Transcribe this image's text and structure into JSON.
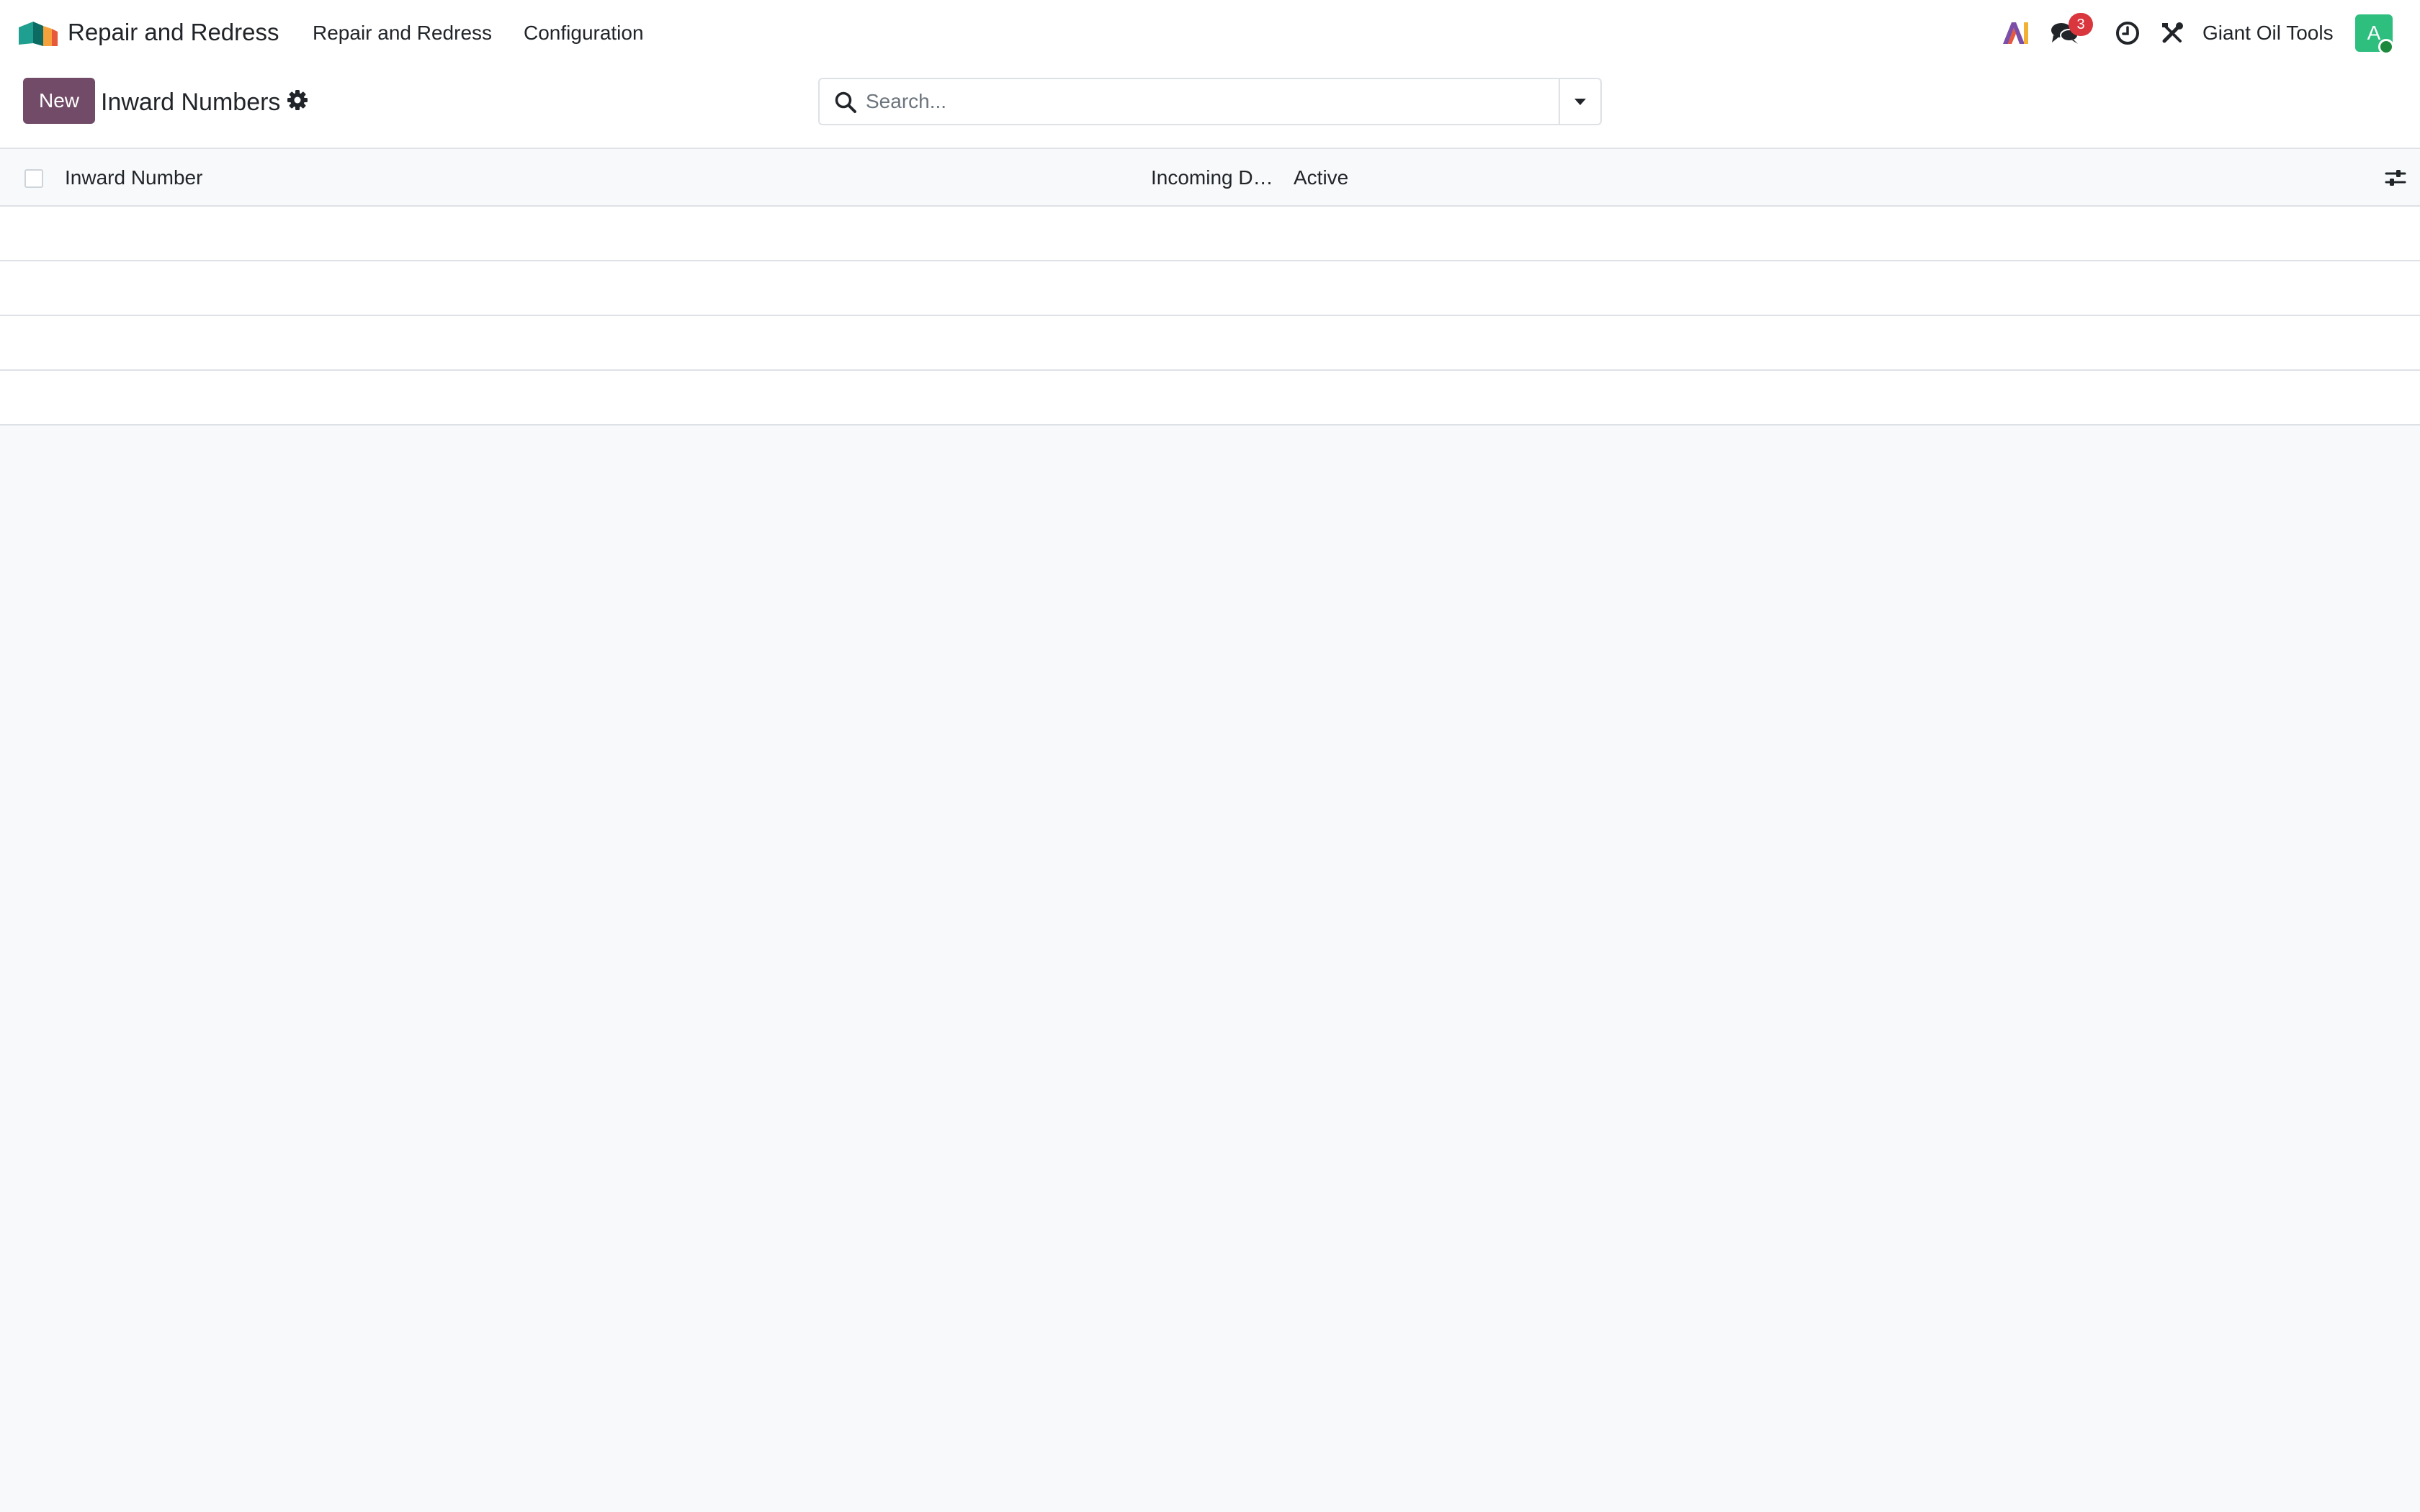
{
  "navbar": {
    "app_name": "Repair and Redress",
    "menus": [
      {
        "label": "Repair and Redress"
      },
      {
        "label": "Configuration"
      }
    ],
    "notification_count": "3",
    "company": "Giant Oil Tools",
    "avatar_letter": "A",
    "icons": [
      "app-logo-icon",
      "ai-icon",
      "chat-icon",
      "clock-icon",
      "tools-icon"
    ]
  },
  "control_panel": {
    "new_label": "New",
    "title": "Inward Numbers",
    "search_placeholder": "Search..."
  },
  "list": {
    "columns": [
      {
        "label": "Inward Number"
      },
      {
        "label": "Incoming D…"
      },
      {
        "label": "Active"
      }
    ],
    "rows": []
  },
  "colors": {
    "brand": "#714b67",
    "badge": "#d9363e",
    "avatar": "#2ebf7f",
    "presence": "#1c8a3d",
    "background": "#f8f9fa"
  }
}
